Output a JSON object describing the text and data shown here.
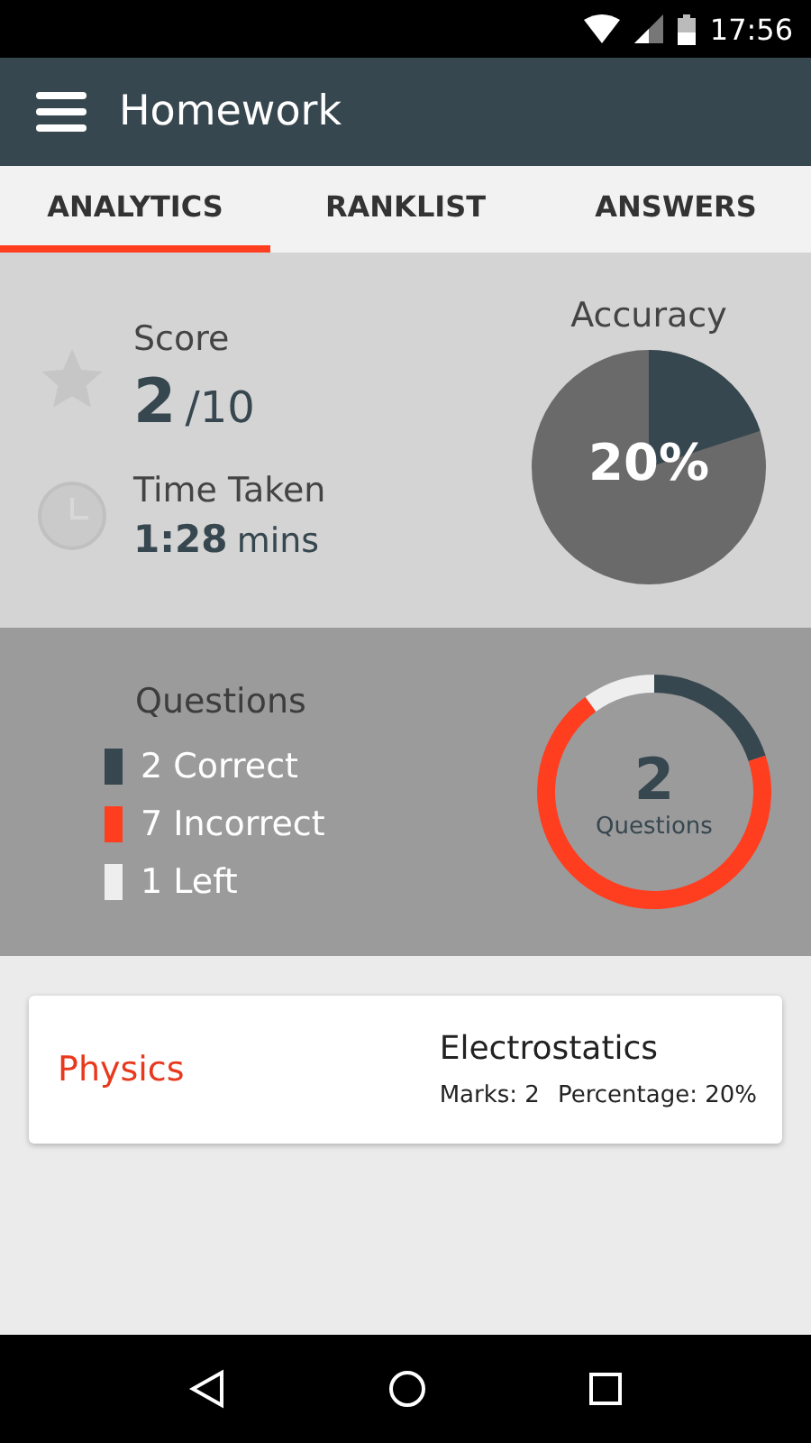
{
  "status_bar": {
    "time": "17:56"
  },
  "app_bar": {
    "title": "Homework"
  },
  "tabs": [
    {
      "label": "ANALYTICS",
      "selected": true
    },
    {
      "label": "RANKLIST",
      "selected": false
    },
    {
      "label": "ANSWERS",
      "selected": false
    }
  ],
  "score": {
    "label": "Score",
    "value": "2",
    "total": "/10"
  },
  "time_taken": {
    "label": "Time Taken",
    "value": "1:28",
    "unit": "mins"
  },
  "accuracy": {
    "label": "Accuracy",
    "value": "20%"
  },
  "questions": {
    "title": "Questions",
    "center_value": "2",
    "center_label": "Questions",
    "legend": [
      {
        "label": "2 Correct",
        "color": "#37474f"
      },
      {
        "label": "7 Incorrect",
        "color": "#ff3d1f"
      },
      {
        "label": "1 Left",
        "color": "#eeeeee"
      }
    ]
  },
  "subjects": [
    {
      "subject": "Physics",
      "topic": "Electrostatics",
      "marks": "Marks: 2",
      "percentage": "Percentage: 20%"
    }
  ]
}
